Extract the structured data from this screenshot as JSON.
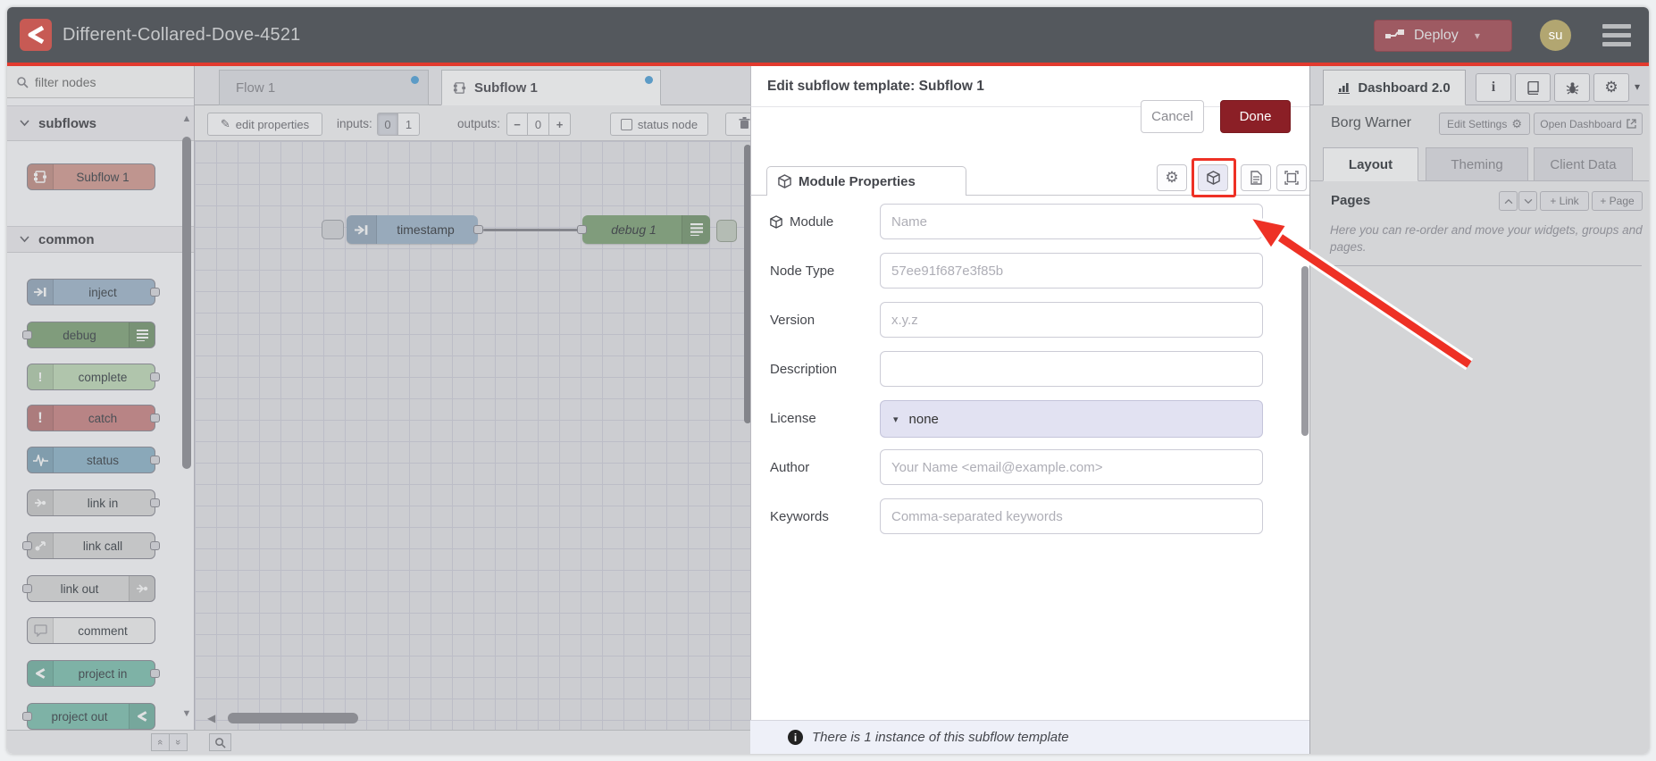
{
  "header": {
    "title": "Different-Collared-Dove-4521",
    "deploy_label": "Deploy",
    "avatar_initials": "su"
  },
  "palette": {
    "filter_placeholder": "filter nodes",
    "categories": [
      {
        "label": "subflows",
        "items": [
          {
            "label": "Subflow 1",
            "color": "#d6a198"
          }
        ]
      },
      {
        "label": "common",
        "items": [
          {
            "label": "inject",
            "color": "#a6bbcf"
          },
          {
            "label": "debug",
            "color": "#87a980"
          },
          {
            "label": "complete",
            "color": "#c3ddbc"
          },
          {
            "label": "catch",
            "color": "#cd8b8b"
          },
          {
            "label": "status",
            "color": "#94b8cc"
          },
          {
            "label": "link in",
            "color": "#dcdcdc"
          },
          {
            "label": "link call",
            "color": "#dcdcdc"
          },
          {
            "label": "link out",
            "color": "#dcdcdc"
          },
          {
            "label": "comment",
            "color": "#f2f2f2"
          },
          {
            "label": "project in",
            "color": "#85c5b5"
          },
          {
            "label": "project out",
            "color": "#85c5b5"
          }
        ]
      }
    ]
  },
  "workspace": {
    "tabs": [
      {
        "label": "Flow 1"
      },
      {
        "label": "Subflow 1"
      }
    ],
    "toolbar": {
      "edit_properties_label": "edit properties",
      "inputs_label": "inputs:",
      "inputs_options": [
        "0",
        "1"
      ],
      "outputs_label": "outputs:",
      "outputs_minus": "−",
      "outputs_value": "0",
      "outputs_plus": "+",
      "status_node_label": "status node"
    },
    "nodes": [
      {
        "label": "timestamp",
        "color": "#a6bbcf"
      },
      {
        "label": "debug 1",
        "color": "#87a980"
      }
    ]
  },
  "edit_panel": {
    "title": "Edit subflow template: Subflow 1",
    "cancel_label": "Cancel",
    "done_label": "Done",
    "tab_label": "Module Properties",
    "fields": [
      {
        "label": "Module",
        "placeholder": "Name"
      },
      {
        "label": "Node Type",
        "placeholder": "57ee91f687e3f85b"
      },
      {
        "label": "Version",
        "placeholder": "x.y.z"
      },
      {
        "label": "Description",
        "placeholder": ""
      },
      {
        "label": "License",
        "value": "none"
      },
      {
        "label": "Author",
        "placeholder": "Your Name <email@example.com>"
      },
      {
        "label": "Keywords",
        "placeholder": "Comma-separated keywords"
      }
    ],
    "footer_note": "There is 1 instance of this subflow template"
  },
  "sidebar": {
    "tab_label": "Dashboard 2.0",
    "group_title": "Borg Warner",
    "edit_settings_label": "Edit Settings",
    "open_dashboard_label": "Open Dashboard",
    "tabs": [
      "Layout",
      "Theming",
      "Client Data"
    ],
    "pages_label": "Pages",
    "add_link_label": "+ Link",
    "add_page_label": "+ Page",
    "help_text": "Here you can re-order and move your widgets, groups and pages."
  },
  "colors": {
    "header_bg": "#54585d",
    "brand_red": "#c75a54",
    "accent_red_line": "#e23a2e",
    "deploy_bg": "#9e5a62",
    "done_bg": "#8b1f26",
    "avatar_bg": "#b2a671",
    "unsaved_dot": "#5aa8dc",
    "annotation_red": "#ee3125"
  }
}
